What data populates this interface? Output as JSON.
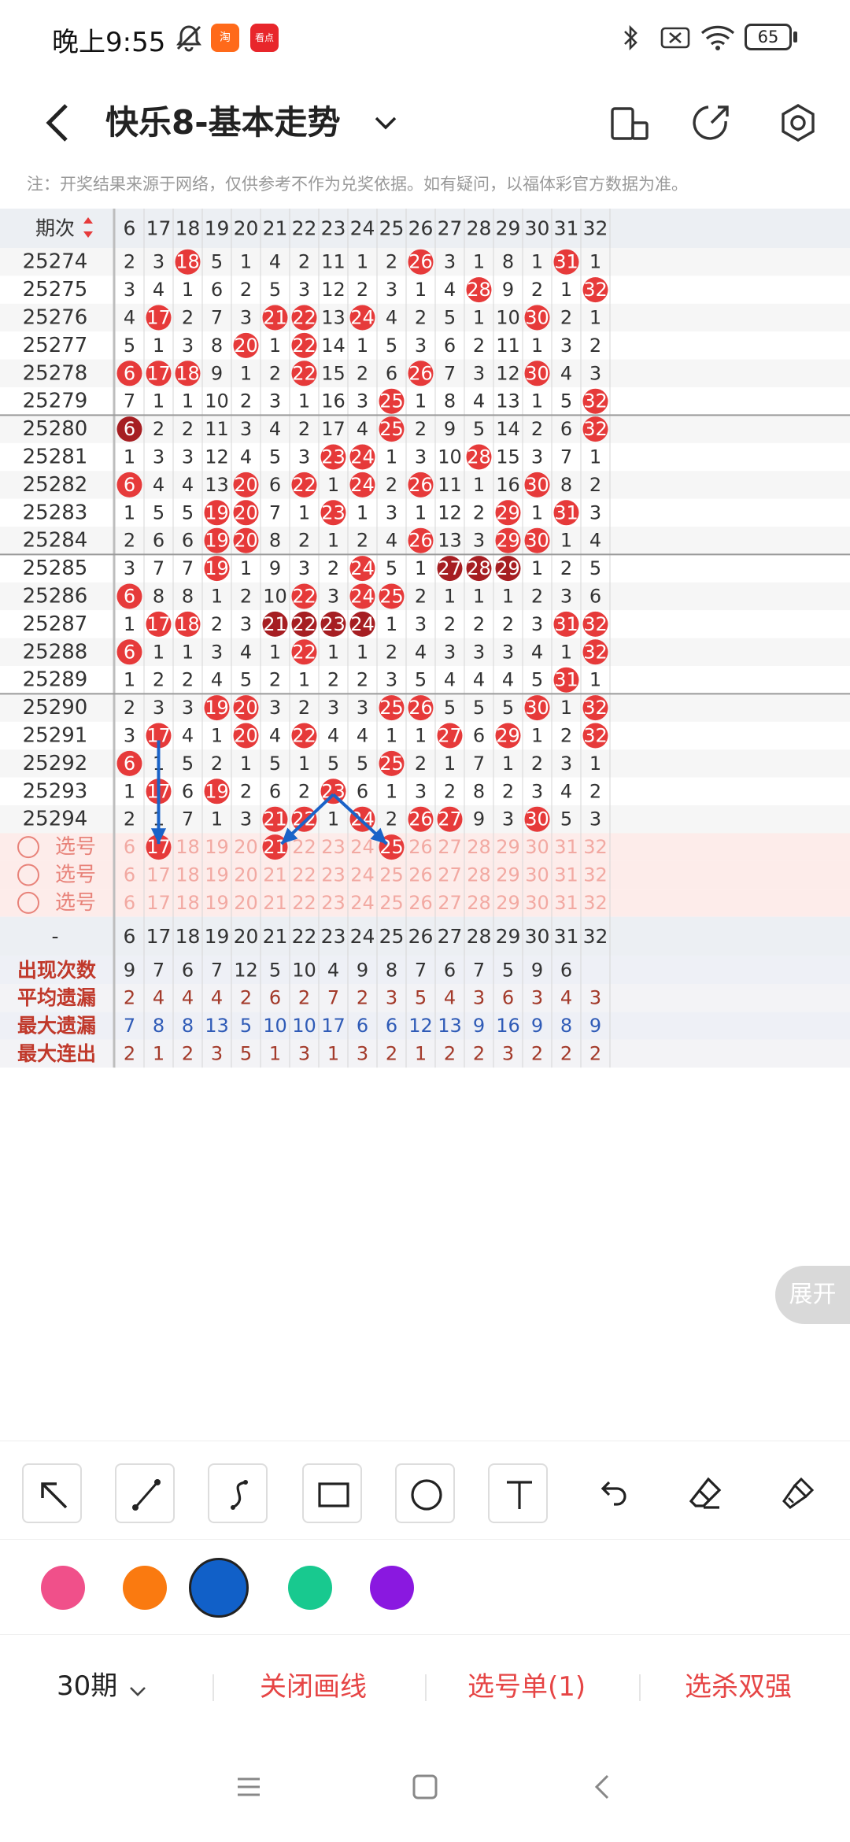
{
  "status_bar": {
    "time": "晚上9:55",
    "app_badge_1": "淘",
    "app_badge_2": "看点",
    "battery": "65"
  },
  "header": {
    "title": "快乐8-基本走势"
  },
  "notice": "注：开奖结果来源于网络，仅供参考不作为兑奖依据。如有疑问，以福体彩官方数据为准。",
  "grid": {
    "period_header": "期次",
    "columns": [
      "6",
      "17",
      "18",
      "19",
      "20",
      "21",
      "22",
      "23",
      "24",
      "25",
      "26",
      "27",
      "28",
      "29",
      "30",
      "31",
      "32"
    ],
    "rows": [
      {
        "period": "25274",
        "cells": [
          "2",
          "3",
          "18",
          "5",
          "1",
          "4",
          "2",
          "11",
          "1",
          "2",
          "26",
          "3",
          "1",
          "8",
          "1",
          "31",
          "1"
        ]
      },
      {
        "period": "25275",
        "cells": [
          "3",
          "4",
          "1",
          "6",
          "2",
          "5",
          "3",
          "12",
          "2",
          "3",
          "1",
          "4",
          "28",
          "9",
          "2",
          "1",
          "32"
        ]
      },
      {
        "period": "25276",
        "cells": [
          "4",
          "17",
          "2",
          "7",
          "3",
          "21",
          "22",
          "13",
          "24",
          "4",
          "2",
          "5",
          "1",
          "10",
          "30",
          "2",
          "1"
        ]
      },
      {
        "period": "25277",
        "cells": [
          "5",
          "1",
          "3",
          "8",
          "20",
          "1",
          "22",
          "14",
          "1",
          "5",
          "3",
          "6",
          "2",
          "11",
          "1",
          "3",
          "2"
        ]
      },
      {
        "period": "25278",
        "cells": [
          "6",
          "17",
          "18",
          "9",
          "1",
          "2",
          "22",
          "15",
          "2",
          "6",
          "26",
          "7",
          "3",
          "12",
          "30",
          "4",
          "3"
        ]
      },
      {
        "period": "25279",
        "cells": [
          "7",
          "1",
          "1",
          "10",
          "2",
          "3",
          "1",
          "16",
          "3",
          "25",
          "1",
          "8",
          "4",
          "13",
          "1",
          "5",
          "32"
        ]
      },
      {
        "period": "25280",
        "cells": [
          "6",
          "2",
          "2",
          "11",
          "3",
          "4",
          "2",
          "17",
          "4",
          "25",
          "2",
          "9",
          "5",
          "14",
          "2",
          "6",
          "32"
        ]
      },
      {
        "period": "25281",
        "cells": [
          "1",
          "3",
          "3",
          "12",
          "4",
          "5",
          "3",
          "23",
          "24",
          "1",
          "3",
          "10",
          "28",
          "15",
          "3",
          "7",
          "1"
        ]
      },
      {
        "period": "25282",
        "cells": [
          "6",
          "4",
          "4",
          "13",
          "20",
          "6",
          "22",
          "1",
          "24",
          "2",
          "26",
          "11",
          "1",
          "16",
          "30",
          "8",
          "2"
        ]
      },
      {
        "period": "25283",
        "cells": [
          "1",
          "5",
          "5",
          "19",
          "20",
          "7",
          "1",
          "23",
          "1",
          "3",
          "1",
          "12",
          "2",
          "29",
          "1",
          "31",
          "3"
        ]
      },
      {
        "period": "25284",
        "cells": [
          "2",
          "6",
          "6",
          "19",
          "20",
          "8",
          "2",
          "1",
          "2",
          "4",
          "26",
          "13",
          "3",
          "29",
          "30",
          "1",
          "4"
        ]
      },
      {
        "period": "25285",
        "cells": [
          "3",
          "7",
          "7",
          "19",
          "1",
          "9",
          "3",
          "2",
          "24",
          "5",
          "1",
          "27",
          "28",
          "29",
          "1",
          "2",
          "5"
        ]
      },
      {
        "period": "25286",
        "cells": [
          "6",
          "8",
          "8",
          "1",
          "2",
          "10",
          "22",
          "3",
          "24",
          "25",
          "2",
          "1",
          "1",
          "1",
          "2",
          "3",
          "6"
        ]
      },
      {
        "period": "25287",
        "cells": [
          "1",
          "17",
          "18",
          "2",
          "3",
          "21",
          "22",
          "23",
          "24",
          "1",
          "3",
          "2",
          "2",
          "2",
          "3",
          "31",
          "32"
        ]
      },
      {
        "period": "25288",
        "cells": [
          "6",
          "1",
          "1",
          "3",
          "4",
          "1",
          "22",
          "1",
          "1",
          "2",
          "4",
          "3",
          "3",
          "3",
          "4",
          "1",
          "32"
        ]
      },
      {
        "period": "25289",
        "cells": [
          "1",
          "2",
          "2",
          "4",
          "5",
          "2",
          "1",
          "2",
          "2",
          "3",
          "5",
          "4",
          "4",
          "4",
          "5",
          "31",
          "1"
        ]
      },
      {
        "period": "25290",
        "cells": [
          "2",
          "3",
          "3",
          "19",
          "20",
          "3",
          "2",
          "3",
          "3",
          "25",
          "26",
          "5",
          "5",
          "5",
          "30",
          "1",
          "32"
        ]
      },
      {
        "period": "25291",
        "cells": [
          "3",
          "17",
          "4",
          "1",
          "20",
          "4",
          "22",
          "4",
          "4",
          "1",
          "1",
          "27",
          "6",
          "29",
          "1",
          "2",
          "32"
        ]
      },
      {
        "period": "25292",
        "cells": [
          "6",
          "1",
          "5",
          "2",
          "1",
          "5",
          "1",
          "5",
          "5",
          "25",
          "2",
          "1",
          "7",
          "1",
          "2",
          "3",
          "1"
        ]
      },
      {
        "period": "25293",
        "cells": [
          "1",
          "17",
          "6",
          "19",
          "2",
          "6",
          "2",
          "23",
          "6",
          "1",
          "3",
          "2",
          "8",
          "2",
          "3",
          "4",
          "2"
        ]
      },
      {
        "period": "25294",
        "cells": [
          "2",
          "1",
          "7",
          "1",
          "3",
          "21",
          "22",
          "1",
          "24",
          "2",
          "26",
          "27",
          "9",
          "3",
          "30",
          "5",
          "3"
        ]
      }
    ],
    "select_label": "选号",
    "select_rows": [
      {
        "cells": [
          "6",
          "17",
          "18",
          "19",
          "20",
          "21",
          "22",
          "23",
          "24",
          "25",
          "26",
          "27",
          "28",
          "29",
          "30",
          "31",
          "32"
        ]
      },
      {
        "cells": [
          "6",
          "17",
          "18",
          "19",
          "20",
          "21",
          "22",
          "23",
          "24",
          "25",
          "26",
          "27",
          "28",
          "29",
          "30",
          "31",
          "32"
        ]
      },
      {
        "cells": [
          "6",
          "17",
          "18",
          "19",
          "20",
          "21",
          "22",
          "23",
          "24",
          "25",
          "26",
          "27",
          "28",
          "29",
          "30",
          "31",
          "32"
        ]
      }
    ],
    "selected_balls": [
      "17",
      "21",
      "25"
    ],
    "footer_header_label": "-",
    "stats": [
      {
        "label": "出现次数",
        "color": "#333333",
        "cells": [
          "9",
          "7",
          "6",
          "7",
          "12",
          "5",
          "10",
          "4",
          "9",
          "8",
          "7",
          "6",
          "7",
          "5",
          "9",
          "6",
          ""
        ]
      },
      {
        "label": "平均遗漏",
        "color": "#a33a2a",
        "cells": [
          "2",
          "4",
          "4",
          "4",
          "2",
          "6",
          "2",
          "7",
          "2",
          "3",
          "5",
          "4",
          "3",
          "6",
          "3",
          "4",
          "3"
        ]
      },
      {
        "label": "最大遗漏",
        "color": "#2f5bb7",
        "cells": [
          "7",
          "8",
          "8",
          "13",
          "5",
          "10",
          "10",
          "17",
          "6",
          "6",
          "12",
          "13",
          "9",
          "16",
          "9",
          "8",
          "9"
        ]
      },
      {
        "label": "最大连出",
        "color": "#a33a2a",
        "cells": [
          "2",
          "1",
          "2",
          "3",
          "5",
          "1",
          "3",
          "1",
          "3",
          "2",
          "1",
          "2",
          "2",
          "3",
          "2",
          "2",
          "2"
        ]
      }
    ]
  },
  "expand_label": "展开",
  "tools": [
    {
      "name": "arrow-tool-icon"
    },
    {
      "name": "line-tool-icon"
    },
    {
      "name": "curve-tool-icon"
    },
    {
      "name": "rectangle-tool-icon"
    },
    {
      "name": "circle-tool-icon"
    },
    {
      "name": "text-tool-icon"
    },
    {
      "name": "undo-icon"
    },
    {
      "name": "eraser-icon"
    },
    {
      "name": "clear-brush-icon"
    }
  ],
  "colors": [
    "#f0508a",
    "#fa7a10",
    "#1160c8",
    "#18c98f",
    "#8a18e0"
  ],
  "selected_color": "#1160c8",
  "bottom_bar": {
    "periods": "30期",
    "close_drawing": "关闭画线",
    "selection_list": "选号单(1)",
    "kill_pick": "选杀双强"
  },
  "theme": {
    "red": "#e63a3a",
    "dark_red": "#a61e22",
    "draw_blue": "#1a63c8"
  }
}
